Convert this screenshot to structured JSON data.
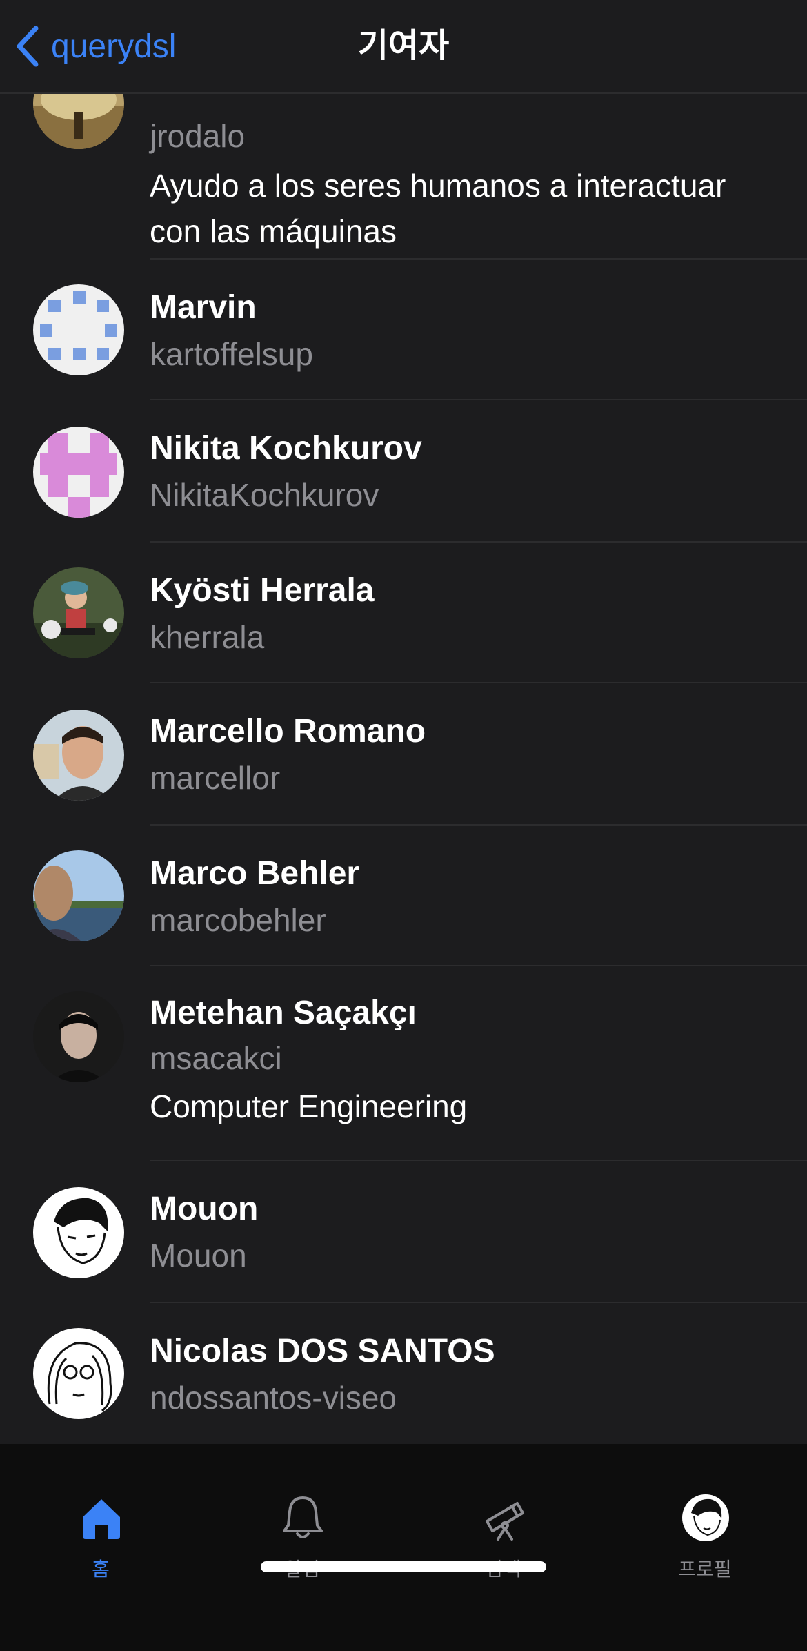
{
  "nav": {
    "back_label": "querydsl",
    "title": "기여자"
  },
  "contributors": [
    {
      "name": "",
      "login": "jrodalo",
      "bio": "Ayudo a los seres humanos a interactuar con las máquinas"
    },
    {
      "name": "Marvin",
      "login": "kartoffelsup",
      "bio": ""
    },
    {
      "name": "Nikita Kochkurov",
      "login": "NikitaKochkurov",
      "bio": ""
    },
    {
      "name": "Kyösti Herrala",
      "login": "kherrala",
      "bio": ""
    },
    {
      "name": "Marcello Romano",
      "login": "marcellor",
      "bio": ""
    },
    {
      "name": "Marco Behler",
      "login": "marcobehler",
      "bio": ""
    },
    {
      "name": "Metehan Saçakçı",
      "login": "msacakci",
      "bio": "Computer Engineering"
    },
    {
      "name": "Mouon",
      "login": "Mouon",
      "bio": ""
    },
    {
      "name": "Nicolas DOS SANTOS",
      "login": "ndossantos-viseo",
      "bio": ""
    }
  ],
  "tabs": [
    {
      "label": "홈",
      "icon": "house-icon",
      "active": true
    },
    {
      "label": "알림",
      "icon": "bell-icon",
      "active": false
    },
    {
      "label": "탐색",
      "icon": "telescope-icon",
      "active": false
    },
    {
      "label": "프로필",
      "icon": "profile-avatar-icon",
      "active": false
    }
  ],
  "colors": {
    "accent": "#3b82f6",
    "background": "#1c1c1e",
    "secondary_text": "#8e8e93",
    "separator": "#2c2c2e",
    "tabbar": "#0d0d0d"
  }
}
